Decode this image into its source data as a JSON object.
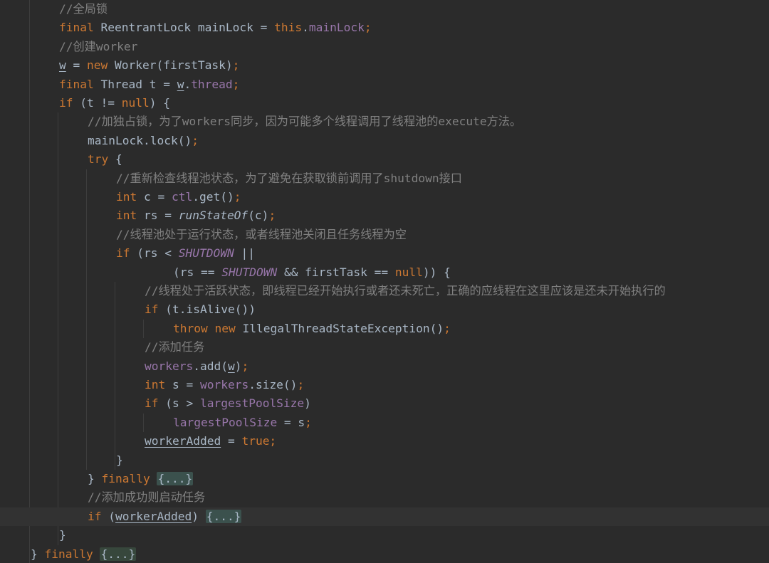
{
  "editor": {
    "lines": [
      {
        "indent": 2,
        "tokens": [
          [
            "cm",
            "//全局锁"
          ]
        ]
      },
      {
        "indent": 2,
        "tokens": [
          [
            "kw",
            "final "
          ],
          [
            "",
            "ReentrantLock mainLock = "
          ],
          [
            "kw",
            "this"
          ],
          [
            "",
            "."
          ],
          [
            "fld",
            "mainLock"
          ],
          [
            "kw",
            ";"
          ]
        ]
      },
      {
        "indent": 2,
        "tokens": [
          [
            "cm",
            "//创建worker"
          ]
        ]
      },
      {
        "indent": 2,
        "tokens": [
          [
            "ul",
            "w"
          ],
          [
            "",
            " = "
          ],
          [
            "kw",
            "new "
          ],
          [
            "",
            "Worker(firstTask)"
          ],
          [
            "kw",
            ";"
          ]
        ]
      },
      {
        "indent": 2,
        "tokens": [
          [
            "kw",
            "final "
          ],
          [
            "",
            "Thread t = "
          ],
          [
            "ul",
            "w"
          ],
          [
            "",
            "."
          ],
          [
            "fld",
            "thread"
          ],
          [
            "kw",
            ";"
          ]
        ]
      },
      {
        "indent": 2,
        "tokens": [
          [
            "kw",
            "if "
          ],
          [
            "",
            "(t != "
          ],
          [
            "kw",
            "null"
          ],
          [
            "",
            ") {"
          ]
        ]
      },
      {
        "indent": 3,
        "tokens": [
          [
            "cm",
            "//加独占锁，为了workers同步，因为可能多个线程调用了线程池的execute方法。"
          ]
        ]
      },
      {
        "indent": 3,
        "tokens": [
          [
            "",
            "mainLock.lock()"
          ],
          [
            "kw",
            ";"
          ]
        ]
      },
      {
        "indent": 3,
        "tokens": [
          [
            "kw",
            "try "
          ],
          [
            "",
            "{"
          ]
        ]
      },
      {
        "indent": 4,
        "tokens": [
          [
            "cm",
            "//重新检查线程池状态，为了避免在获取锁前调用了shutdown接口"
          ]
        ]
      },
      {
        "indent": 4,
        "tokens": [
          [
            "kw",
            "int "
          ],
          [
            "",
            "c = "
          ],
          [
            "fld",
            "ctl"
          ],
          [
            "",
            ".get()"
          ],
          [
            "kw",
            ";"
          ]
        ]
      },
      {
        "indent": 4,
        "tokens": [
          [
            "kw",
            "int "
          ],
          [
            "",
            "rs = "
          ],
          [
            "mi",
            "runStateOf"
          ],
          [
            "",
            "(c)"
          ],
          [
            "kw",
            ";"
          ]
        ]
      },
      {
        "indent": 4,
        "tokens": [
          [
            "cm",
            "//线程池处于运行状态，或者线程池关闭且任务线程为空"
          ]
        ]
      },
      {
        "indent": 4,
        "tokens": [
          [
            "kw",
            "if "
          ],
          [
            "",
            "(rs < "
          ],
          [
            "fldi",
            "SHUTDOWN"
          ],
          [
            "",
            " ||"
          ]
        ]
      },
      {
        "indent": 6,
        "tokens": [
          [
            "",
            "(rs == "
          ],
          [
            "fldi",
            "SHUTDOWN"
          ],
          [
            "",
            " && firstTask == "
          ],
          [
            "kw",
            "null"
          ],
          [
            "",
            ")) {"
          ]
        ]
      },
      {
        "indent": 5,
        "tokens": [
          [
            "cm",
            "//线程处于活跃状态，即线程已经开始执行或者还未死亡，正确的应线程在这里应该是还未开始执行的"
          ]
        ]
      },
      {
        "indent": 5,
        "tokens": [
          [
            "kw",
            "if "
          ],
          [
            "",
            "(t.isAlive())"
          ]
        ]
      },
      {
        "indent": 6,
        "tokens": [
          [
            "kw",
            "throw new "
          ],
          [
            "",
            "IllegalThreadStateException()"
          ],
          [
            "kw",
            ";"
          ]
        ]
      },
      {
        "indent": 5,
        "tokens": [
          [
            "cm",
            "//添加任务"
          ]
        ]
      },
      {
        "indent": 5,
        "tokens": [
          [
            "fld",
            "workers"
          ],
          [
            "",
            ".add("
          ],
          [
            "ul",
            "w"
          ],
          [
            "",
            ")"
          ],
          [
            "kw",
            ";"
          ]
        ]
      },
      {
        "indent": 5,
        "tokens": [
          [
            "kw",
            "int "
          ],
          [
            "",
            "s = "
          ],
          [
            "fld",
            "workers"
          ],
          [
            "",
            ".size()"
          ],
          [
            "kw",
            ";"
          ]
        ]
      },
      {
        "indent": 5,
        "tokens": [
          [
            "kw",
            "if "
          ],
          [
            "",
            "(s > "
          ],
          [
            "fld",
            "largestPoolSize"
          ],
          [
            "",
            ")"
          ]
        ]
      },
      {
        "indent": 6,
        "tokens": [
          [
            "fld",
            "largestPoolSize"
          ],
          [
            "",
            " = s"
          ],
          [
            "kw",
            ";"
          ]
        ]
      },
      {
        "indent": 5,
        "tokens": [
          [
            "ul",
            "workerAdded"
          ],
          [
            "",
            " = "
          ],
          [
            "kw",
            "true;"
          ]
        ]
      },
      {
        "indent": 4,
        "tokens": [
          [
            "",
            "}"
          ]
        ]
      },
      {
        "indent": 3,
        "tokens": [
          [
            "",
            "} "
          ],
          [
            "kw",
            "finally "
          ],
          [
            "fold",
            "{...}"
          ]
        ]
      },
      {
        "indent": 3,
        "tokens": [
          [
            "cm",
            "//添加成功则启动任务"
          ]
        ]
      },
      {
        "indent": 3,
        "tokens": [
          [
            "kw",
            "if "
          ],
          [
            "",
            "("
          ],
          [
            "ul",
            "workerAdded"
          ],
          [
            "",
            ") "
          ],
          [
            "fold",
            "{...}"
          ]
        ]
      },
      {
        "indent": 2,
        "tokens": [
          [
            "",
            "}"
          ]
        ]
      },
      {
        "indent": 1,
        "tokens": [
          [
            "",
            "} "
          ],
          [
            "kw",
            "finally "
          ],
          [
            "foldg",
            "{...}"
          ]
        ]
      }
    ]
  }
}
